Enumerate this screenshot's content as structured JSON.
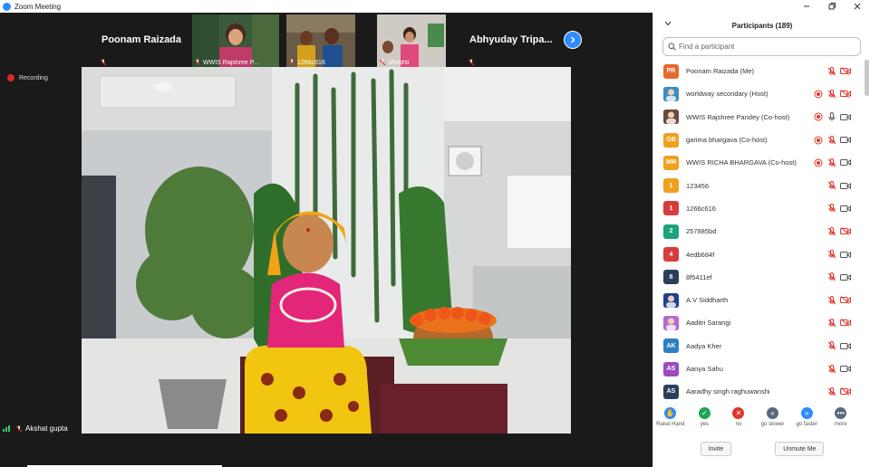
{
  "window": {
    "title": "Zoom Meeting",
    "minimize": "⌄",
    "restore": "❐",
    "close": "✕"
  },
  "strip": {
    "tiles": [
      {
        "kind": "name",
        "name": "Poonam Raizada"
      },
      {
        "kind": "video",
        "label": "WWIS Rajshree P...",
        "scene": "woman-green"
      },
      {
        "kind": "video",
        "label": "1266c616",
        "scene": "family"
      },
      {
        "kind": "video",
        "label": "Shrishti",
        "scene": "girl"
      },
      {
        "kind": "name",
        "name": "Abhyuday Tripa..."
      }
    ]
  },
  "recording": {
    "label": "Recording"
  },
  "self": {
    "name": "Akshat gupta"
  },
  "participants": {
    "title": "Participants (189)",
    "search_placeholder": "Find a participant",
    "list": [
      {
        "initials": "PR",
        "color": "#e8692c",
        "name": "Poonam Raizada (Me)",
        "icons": [
          "mic-off",
          "video-off"
        ]
      },
      {
        "initials": "",
        "color": "#3a8ec0",
        "pic": true,
        "name": "worldway secondary (Host)",
        "icons": [
          "rec",
          "mic-off",
          "video-off"
        ]
      },
      {
        "initials": "",
        "color": "#6b4a3a",
        "pic": true,
        "name": "WWIS Rajshree Pandey (Co-host)",
        "icons": [
          "rec",
          "mic-on",
          "video-on"
        ]
      },
      {
        "initials": "GB",
        "color": "#f0a020",
        "name": "garima bhargava (Co-host)",
        "icons": [
          "rec",
          "mic-off",
          "video-on"
        ]
      },
      {
        "initials": "WR",
        "color": "#f0a020",
        "name": "WWIS RICHA BHARGAVA (Co-host)",
        "icons": [
          "rec",
          "mic-off",
          "video-on"
        ]
      },
      {
        "initials": "1",
        "color": "#f0a020",
        "name": "123456",
        "icons": [
          "mic-off",
          "video-on"
        ]
      },
      {
        "initials": "1",
        "color": "#d63c3c",
        "name": "1266c616",
        "icons": [
          "mic-off",
          "video-on"
        ]
      },
      {
        "initials": "2",
        "color": "#1aa37a",
        "name": "257885bd",
        "icons": [
          "mic-off",
          "video-off"
        ]
      },
      {
        "initials": "4",
        "color": "#d63c3c",
        "name": "4edb684f",
        "icons": [
          "mic-off",
          "video-on"
        ]
      },
      {
        "initials": "8",
        "color": "#2b3f5c",
        "name": "8f5411ef",
        "icons": [
          "mic-off",
          "video-on"
        ]
      },
      {
        "initials": "",
        "color": "#1f3f8f",
        "pic": true,
        "name": "A.V Siddharth",
        "icons": [
          "mic-off",
          "video-off"
        ]
      },
      {
        "initials": "",
        "color": "#b56ad0",
        "pic": true,
        "name": "Aaditri Sarangi",
        "icons": [
          "mic-off",
          "video-off"
        ]
      },
      {
        "initials": "AK",
        "color": "#2b7fc4",
        "name": "Aadya Kher",
        "icons": [
          "mic-off",
          "video-on"
        ]
      },
      {
        "initials": "AS",
        "color": "#9b4bc0",
        "name": "Aanya Sahu",
        "icons": [
          "mic-off",
          "video-on"
        ]
      },
      {
        "initials": "AS",
        "color": "#2b3f5c",
        "name": "Aaradhy singh raghuwanshi",
        "icons": [
          "mic-off",
          "video-off"
        ]
      }
    ]
  },
  "reactions": [
    {
      "key": "raise-hand",
      "label": "Raise Hand",
      "symbol": "✋",
      "color": "#2d8cff"
    },
    {
      "key": "yes",
      "label": "yes",
      "symbol": "✓",
      "color": "#1ea552"
    },
    {
      "key": "no",
      "label": "no",
      "symbol": "✕",
      "color": "#e0352b"
    },
    {
      "key": "go-slower",
      "label": "go slower",
      "symbol": "«",
      "color": "#5a6a7a"
    },
    {
      "key": "go-faster",
      "label": "go faster",
      "symbol": "»",
      "color": "#2d8cff"
    },
    {
      "key": "more",
      "label": "more",
      "symbol": "•••",
      "color": "#5a6a7a"
    }
  ],
  "buttons": {
    "invite": "Invite",
    "unmute_me": "Unmute Me"
  }
}
